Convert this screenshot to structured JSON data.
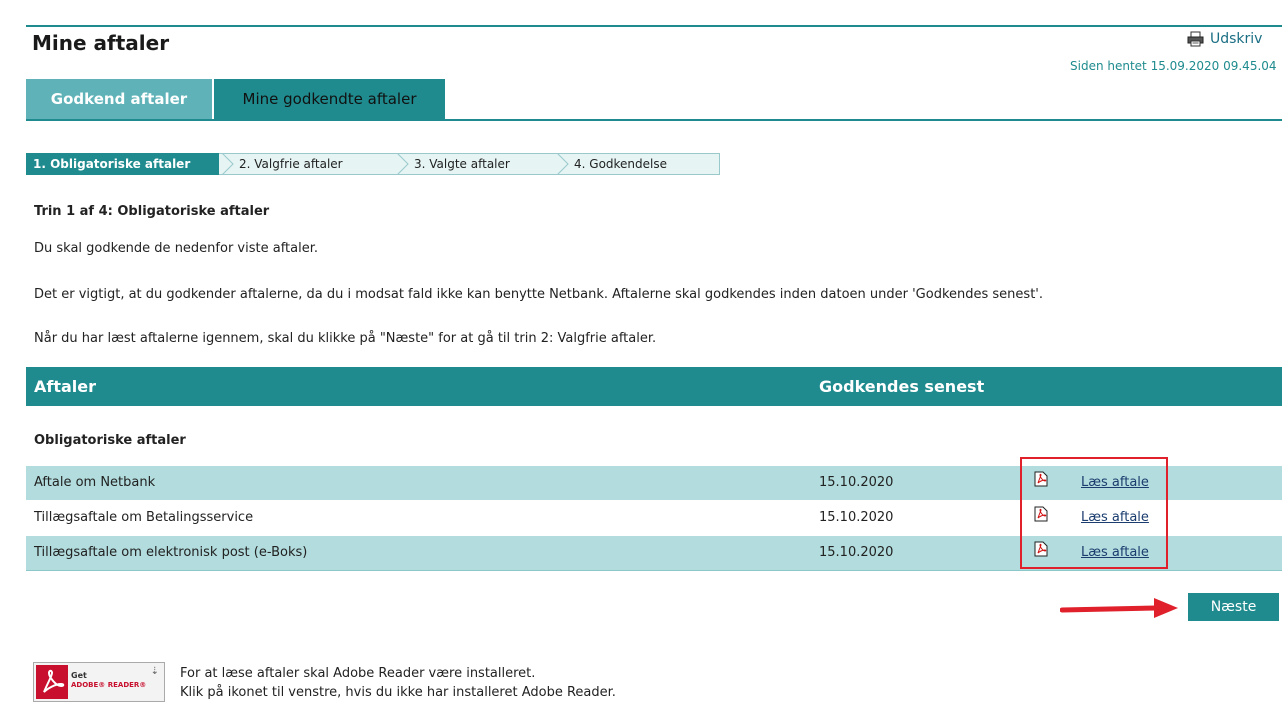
{
  "header": {
    "title": "Mine aftaler",
    "print_label": "Udskriv",
    "fetched": "Siden hentet 15.09.2020 09.45.04"
  },
  "tabs": [
    {
      "label": "Godkend aftaler",
      "active": true
    },
    {
      "label": "Mine godkendte aftaler",
      "active": false
    }
  ],
  "steps": [
    {
      "label": "1. Obligatoriske aftaler",
      "active": true
    },
    {
      "label": "2. Valgfrie aftaler",
      "active": false
    },
    {
      "label": "3. Valgte aftaler",
      "active": false
    },
    {
      "label": "4. Godkendelse",
      "active": false
    }
  ],
  "content": {
    "step_heading": "Trin 1 af 4: Obligatoriske aftaler",
    "para1": "Du skal godkende de nedenfor viste aftaler.",
    "para2": "Det er vigtigt, at du godkender aftalerne, da du i modsat fald ikke kan benytte Netbank. Aftalerne skal godkendes inden datoen under 'Godkendes senest'.",
    "para3": "Når du har læst aftalerne igennem, skal du klikke på \"Næste\" for at gå til trin 2: Valgfrie aftaler."
  },
  "table": {
    "col_title": "Aftaler",
    "col_date": "Godkendes senest",
    "group_label": "Obligatoriske aftaler",
    "rows": [
      {
        "name": "Aftale om Netbank",
        "date": "15.10.2020",
        "link": "Læs aftale"
      },
      {
        "name": "Tillægsaftale om Betalingsservice",
        "date": "15.10.2020",
        "link": "Læs aftale"
      },
      {
        "name": "Tillægsaftale om elektronisk post (e-Boks)",
        "date": "15.10.2020",
        "link": "Læs aftale"
      }
    ]
  },
  "next_label": "Næste",
  "adobe": {
    "badge_get": "Get",
    "badge_reader": "ADOBE® READER®",
    "line1": "For at læse aftaler skal Adobe Reader være installeret.",
    "line2": "Klik på ikonet til venstre, hvis du ikke har installeret Adobe Reader."
  },
  "colors": {
    "accent": "#1f8b8e",
    "row_alt": "#b2dcdd",
    "highlight": "#e0202a"
  }
}
